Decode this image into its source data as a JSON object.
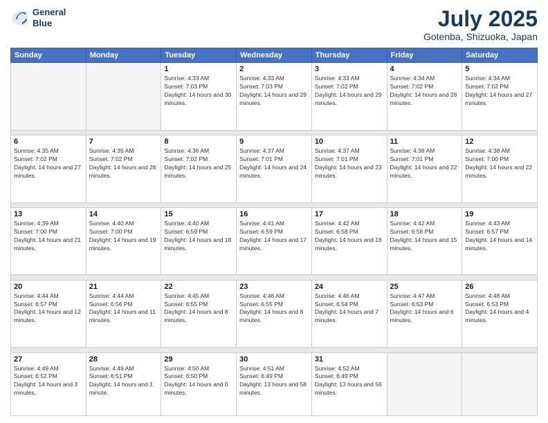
{
  "header": {
    "logo_line1": "General",
    "logo_line2": "Blue",
    "month_year": "July 2025",
    "location": "Gotenba, Shizuoka, Japan"
  },
  "weekdays": [
    "Sunday",
    "Monday",
    "Tuesday",
    "Wednesday",
    "Thursday",
    "Friday",
    "Saturday"
  ],
  "weeks": [
    [
      {
        "num": "",
        "sunrise": "",
        "sunset": "",
        "daylight": "",
        "empty": true
      },
      {
        "num": "",
        "sunrise": "",
        "sunset": "",
        "daylight": "",
        "empty": true
      },
      {
        "num": "1",
        "sunrise": "Sunrise: 4:33 AM",
        "sunset": "Sunset: 7:03 PM",
        "daylight": "Daylight: 14 hours and 30 minutes."
      },
      {
        "num": "2",
        "sunrise": "Sunrise: 4:33 AM",
        "sunset": "Sunset: 7:03 PM",
        "daylight": "Daylight: 14 hours and 29 minutes."
      },
      {
        "num": "3",
        "sunrise": "Sunrise: 4:33 AM",
        "sunset": "Sunset: 7:02 PM",
        "daylight": "Daylight: 14 hours and 29 minutes."
      },
      {
        "num": "4",
        "sunrise": "Sunrise: 4:34 AM",
        "sunset": "Sunset: 7:02 PM",
        "daylight": "Daylight: 14 hours and 28 minutes."
      },
      {
        "num": "5",
        "sunrise": "Sunrise: 4:34 AM",
        "sunset": "Sunset: 7:02 PM",
        "daylight": "Daylight: 14 hours and 27 minutes."
      }
    ],
    [
      {
        "num": "6",
        "sunrise": "Sunrise: 4:35 AM",
        "sunset": "Sunset: 7:02 PM",
        "daylight": "Daylight: 14 hours and 27 minutes."
      },
      {
        "num": "7",
        "sunrise": "Sunrise: 4:35 AM",
        "sunset": "Sunset: 7:02 PM",
        "daylight": "Daylight: 14 hours and 26 minutes."
      },
      {
        "num": "8",
        "sunrise": "Sunrise: 4:36 AM",
        "sunset": "Sunset: 7:02 PM",
        "daylight": "Daylight: 14 hours and 25 minutes."
      },
      {
        "num": "9",
        "sunrise": "Sunrise: 4:37 AM",
        "sunset": "Sunset: 7:01 PM",
        "daylight": "Daylight: 14 hours and 24 minutes."
      },
      {
        "num": "10",
        "sunrise": "Sunrise: 4:37 AM",
        "sunset": "Sunset: 7:01 PM",
        "daylight": "Daylight: 14 hours and 23 minutes."
      },
      {
        "num": "11",
        "sunrise": "Sunrise: 4:38 AM",
        "sunset": "Sunset: 7:01 PM",
        "daylight": "Daylight: 14 hours and 22 minutes."
      },
      {
        "num": "12",
        "sunrise": "Sunrise: 4:38 AM",
        "sunset": "Sunset: 7:00 PM",
        "daylight": "Daylight: 14 hours and 22 minutes."
      }
    ],
    [
      {
        "num": "13",
        "sunrise": "Sunrise: 4:39 AM",
        "sunset": "Sunset: 7:00 PM",
        "daylight": "Daylight: 14 hours and 21 minutes."
      },
      {
        "num": "14",
        "sunrise": "Sunrise: 4:40 AM",
        "sunset": "Sunset: 7:00 PM",
        "daylight": "Daylight: 14 hours and 19 minutes."
      },
      {
        "num": "15",
        "sunrise": "Sunrise: 4:40 AM",
        "sunset": "Sunset: 6:59 PM",
        "daylight": "Daylight: 14 hours and 18 minutes."
      },
      {
        "num": "16",
        "sunrise": "Sunrise: 4:41 AM",
        "sunset": "Sunset: 6:59 PM",
        "daylight": "Daylight: 14 hours and 17 minutes."
      },
      {
        "num": "17",
        "sunrise": "Sunrise: 4:42 AM",
        "sunset": "Sunset: 6:58 PM",
        "daylight": "Daylight: 14 hours and 16 minutes."
      },
      {
        "num": "18",
        "sunrise": "Sunrise: 4:42 AM",
        "sunset": "Sunset: 6:58 PM",
        "daylight": "Daylight: 14 hours and 15 minutes."
      },
      {
        "num": "19",
        "sunrise": "Sunrise: 4:43 AM",
        "sunset": "Sunset: 6:57 PM",
        "daylight": "Daylight: 14 hours and 14 minutes."
      }
    ],
    [
      {
        "num": "20",
        "sunrise": "Sunrise: 4:44 AM",
        "sunset": "Sunset: 6:57 PM",
        "daylight": "Daylight: 14 hours and 12 minutes."
      },
      {
        "num": "21",
        "sunrise": "Sunrise: 4:44 AM",
        "sunset": "Sunset: 6:56 PM",
        "daylight": "Daylight: 14 hours and 11 minutes."
      },
      {
        "num": "22",
        "sunrise": "Sunrise: 4:45 AM",
        "sunset": "Sunset: 6:55 PM",
        "daylight": "Daylight: 14 hours and 8 minutes."
      },
      {
        "num": "23",
        "sunrise": "Sunrise: 4:46 AM",
        "sunset": "Sunset: 6:55 PM",
        "daylight": "Daylight: 14 hours and 8 minutes."
      },
      {
        "num": "24",
        "sunrise": "Sunrise: 4:46 AM",
        "sunset": "Sunset: 6:54 PM",
        "daylight": "Daylight: 14 hours and 7 minutes."
      },
      {
        "num": "25",
        "sunrise": "Sunrise: 4:47 AM",
        "sunset": "Sunset: 6:53 PM",
        "daylight": "Daylight: 14 hours and 6 minutes."
      },
      {
        "num": "26",
        "sunrise": "Sunrise: 4:48 AM",
        "sunset": "Sunset: 6:53 PM",
        "daylight": "Daylight: 14 hours and 4 minutes."
      }
    ],
    [
      {
        "num": "27",
        "sunrise": "Sunrise: 4:49 AM",
        "sunset": "Sunset: 6:52 PM",
        "daylight": "Daylight: 14 hours and 3 minutes."
      },
      {
        "num": "28",
        "sunrise": "Sunrise: 4:49 AM",
        "sunset": "Sunset: 6:51 PM",
        "daylight": "Daylight: 14 hours and 1 minute."
      },
      {
        "num": "29",
        "sunrise": "Sunrise: 4:50 AM",
        "sunset": "Sunset: 6:50 PM",
        "daylight": "Daylight: 14 hours and 0 minutes."
      },
      {
        "num": "30",
        "sunrise": "Sunrise: 4:51 AM",
        "sunset": "Sunset: 6:49 PM",
        "daylight": "Daylight: 13 hours and 58 minutes."
      },
      {
        "num": "31",
        "sunrise": "Sunrise: 4:52 AM",
        "sunset": "Sunset: 6:49 PM",
        "daylight": "Daylight: 13 hours and 56 minutes."
      },
      {
        "num": "",
        "sunrise": "",
        "sunset": "",
        "daylight": "",
        "empty": true
      },
      {
        "num": "",
        "sunrise": "",
        "sunset": "",
        "daylight": "",
        "empty": true
      }
    ]
  ]
}
